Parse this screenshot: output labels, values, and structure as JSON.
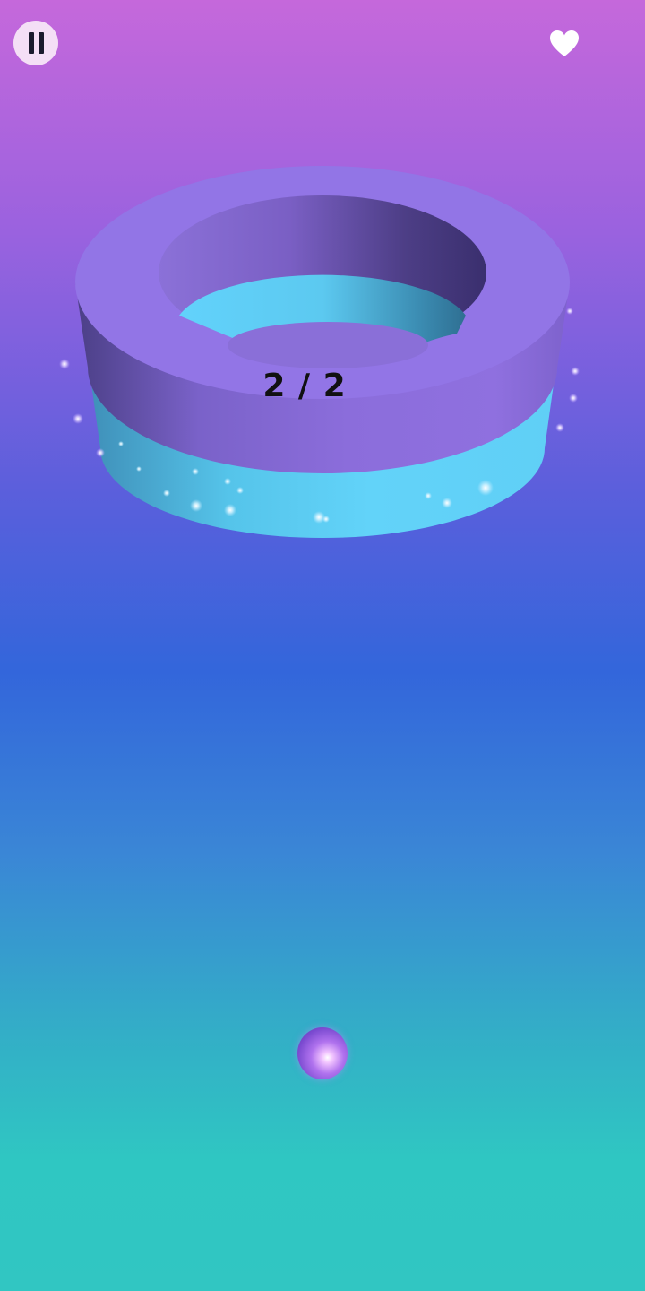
{
  "hud": {
    "pause_icon": "pause-icon",
    "lives_icon": "heart-icon",
    "heart_color": "#ffffff"
  },
  "ring": {
    "progress_text": "2 / 2",
    "top_color": "#9275e6",
    "band_color": "#5fd2f7"
  },
  "player": {
    "ball_color": "#a36ae8"
  }
}
